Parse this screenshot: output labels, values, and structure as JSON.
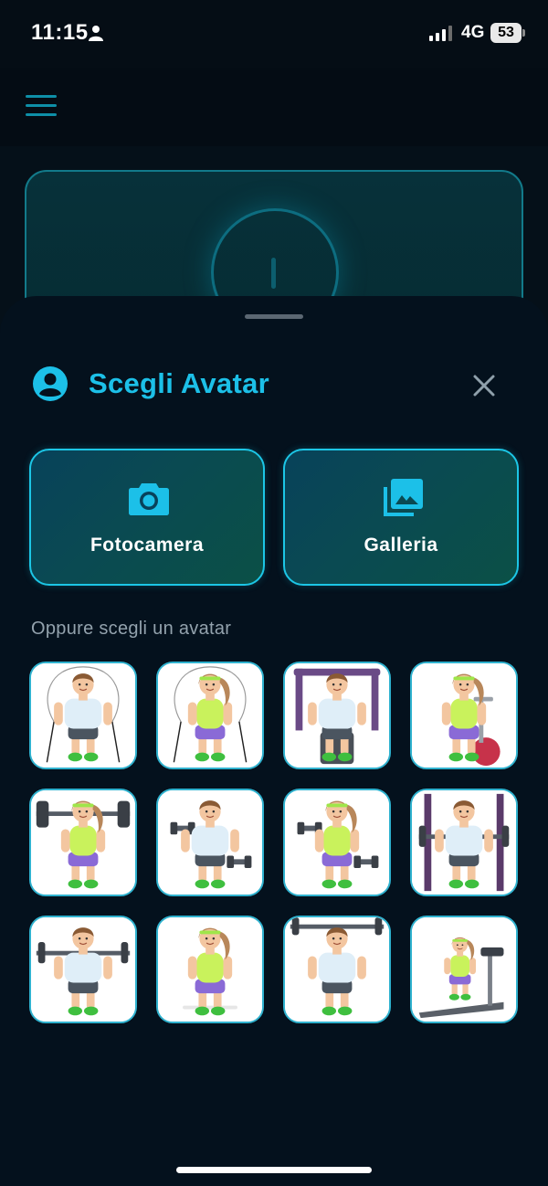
{
  "status_bar": {
    "time": "11:15",
    "network": "4G",
    "battery": "53"
  },
  "sheet": {
    "title": "Scegli Avatar",
    "actions": [
      {
        "label": "Fotocamera",
        "icon": "camera-icon"
      },
      {
        "label": "Galleria",
        "icon": "gallery-icon"
      }
    ],
    "subtitle": "Oppure scegli un avatar",
    "avatars": [
      {
        "name": "avatar-jump-rope-man",
        "gender": "m",
        "scene": "rope"
      },
      {
        "name": "avatar-jump-rope-woman",
        "gender": "f",
        "scene": "rope"
      },
      {
        "name": "avatar-shoulder-press-machine-man",
        "gender": "m",
        "scene": "machine"
      },
      {
        "name": "avatar-exercise-bike-woman",
        "gender": "f",
        "scene": "bike"
      },
      {
        "name": "avatar-barbell-squat-woman",
        "gender": "f",
        "scene": "barbell-shoulder"
      },
      {
        "name": "avatar-dumbbell-man",
        "gender": "m",
        "scene": "dumbbell"
      },
      {
        "name": "avatar-dumbbell-woman",
        "gender": "f",
        "scene": "dumbbell"
      },
      {
        "name": "avatar-squat-rack-man",
        "gender": "m",
        "scene": "rack"
      },
      {
        "name": "avatar-barbell-curl-man",
        "gender": "m",
        "scene": "barbell-chest"
      },
      {
        "name": "avatar-lunge-woman",
        "gender": "f",
        "scene": "lunge"
      },
      {
        "name": "avatar-overhead-press-man",
        "gender": "m",
        "scene": "overhead"
      },
      {
        "name": "avatar-treadmill-woman",
        "gender": "f",
        "scene": "treadmill"
      }
    ]
  },
  "colors": {
    "accent": "#1cc0e8",
    "background": "#04111d",
    "button_border": "#1cc6e6"
  }
}
